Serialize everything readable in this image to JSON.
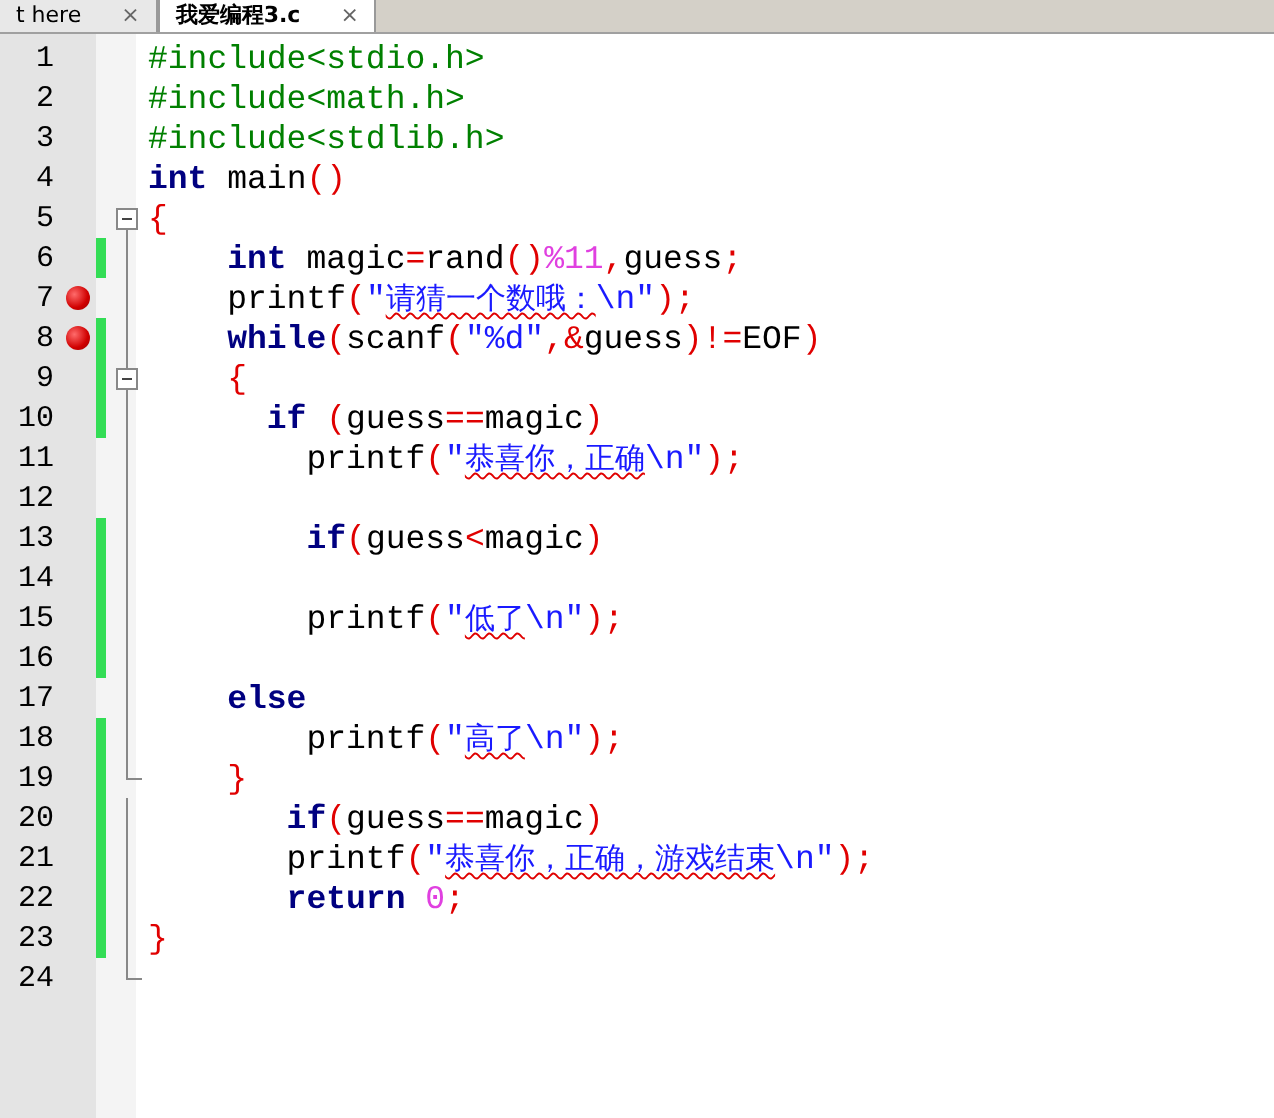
{
  "tabs": [
    {
      "label": "t here",
      "close": "×",
      "selected": false
    },
    {
      "label": "我爱编程3.c",
      "close": "×",
      "selected": true
    }
  ],
  "editor": {
    "lines": [
      {
        "number": "1",
        "breakpoint": false,
        "changed": false,
        "fold_toggle": false,
        "fold_end": false,
        "tokens": [
          {
            "kind": "preproc",
            "text": "#include<stdio.h>"
          }
        ]
      },
      {
        "number": "2",
        "breakpoint": false,
        "changed": false,
        "fold_toggle": false,
        "fold_end": false,
        "tokens": [
          {
            "kind": "preproc",
            "text": "#include<math.h>"
          }
        ]
      },
      {
        "number": "3",
        "breakpoint": false,
        "changed": false,
        "fold_toggle": false,
        "fold_end": false,
        "tokens": [
          {
            "kind": "preproc",
            "text": "#include<stdlib.h>"
          }
        ]
      },
      {
        "number": "4",
        "breakpoint": false,
        "changed": false,
        "fold_toggle": false,
        "fold_end": false,
        "tokens": [
          {
            "kind": "keyword",
            "text": "int"
          },
          {
            "kind": "plain",
            "text": " main"
          },
          {
            "kind": "operator",
            "text": "()"
          }
        ]
      },
      {
        "number": "5",
        "breakpoint": false,
        "changed": false,
        "fold_toggle": true,
        "fold_end": false,
        "tokens": [
          {
            "kind": "operator",
            "text": "{"
          }
        ]
      },
      {
        "number": "6",
        "breakpoint": false,
        "changed": true,
        "fold_toggle": false,
        "fold_end": false,
        "tokens": [
          {
            "kind": "keyword",
            "text": "    int"
          },
          {
            "kind": "plain",
            "text": " magic"
          },
          {
            "kind": "operator",
            "text": "="
          },
          {
            "kind": "plain",
            "text": "rand"
          },
          {
            "kind": "operator",
            "text": "()"
          },
          {
            "kind": "number",
            "text": "%11"
          },
          {
            "kind": "operator",
            "text": ","
          },
          {
            "kind": "plain",
            "text": "guess"
          },
          {
            "kind": "operator",
            "text": ";"
          }
        ]
      },
      {
        "number": "7",
        "breakpoint": true,
        "changed": false,
        "fold_toggle": false,
        "fold_end": false,
        "tokens": [
          {
            "kind": "plain",
            "text": "    printf"
          },
          {
            "kind": "operator",
            "text": "("
          },
          {
            "kind": "string",
            "text": "\""
          },
          {
            "kind": "string_flagged",
            "text": "请猜一个数哦："
          },
          {
            "kind": "string",
            "text": "\\n\""
          },
          {
            "kind": "operator",
            "text": ");"
          }
        ]
      },
      {
        "number": "8",
        "breakpoint": true,
        "changed": true,
        "fold_toggle": false,
        "fold_end": false,
        "tokens": [
          {
            "kind": "keyword",
            "text": "    while"
          },
          {
            "kind": "operator",
            "text": "("
          },
          {
            "kind": "plain",
            "text": "scanf"
          },
          {
            "kind": "operator",
            "text": "("
          },
          {
            "kind": "string",
            "text": "\"%d\""
          },
          {
            "kind": "operator",
            "text": ",&"
          },
          {
            "kind": "plain",
            "text": "guess"
          },
          {
            "kind": "operator",
            "text": ")!="
          },
          {
            "kind": "plain",
            "text": "EOF"
          },
          {
            "kind": "operator",
            "text": ")"
          }
        ]
      },
      {
        "number": "9",
        "breakpoint": false,
        "changed": true,
        "fold_toggle": true,
        "fold_end": false,
        "tokens": [
          {
            "kind": "operator",
            "text": "    {"
          }
        ]
      },
      {
        "number": "10",
        "breakpoint": false,
        "changed": true,
        "fold_toggle": false,
        "fold_end": false,
        "tokens": [
          {
            "kind": "keyword",
            "text": "      if"
          },
          {
            "kind": "operator",
            "text": " ("
          },
          {
            "kind": "plain",
            "text": "guess"
          },
          {
            "kind": "operator",
            "text": "=="
          },
          {
            "kind": "plain",
            "text": "magic"
          },
          {
            "kind": "operator",
            "text": ")"
          }
        ]
      },
      {
        "number": "11",
        "breakpoint": false,
        "changed": false,
        "fold_toggle": false,
        "fold_end": false,
        "tokens": [
          {
            "kind": "plain",
            "text": "        printf"
          },
          {
            "kind": "operator",
            "text": "("
          },
          {
            "kind": "string",
            "text": "\""
          },
          {
            "kind": "string_flagged",
            "text": "恭喜你，正确"
          },
          {
            "kind": "string",
            "text": "\\n\""
          },
          {
            "kind": "operator",
            "text": ");"
          }
        ]
      },
      {
        "number": "12",
        "breakpoint": false,
        "changed": false,
        "fold_toggle": false,
        "fold_end": false
      },
      {
        "number": "13",
        "breakpoint": false,
        "changed": true,
        "fold_toggle": false,
        "fold_end": false,
        "tokens": [
          {
            "kind": "keyword",
            "text": "        if"
          },
          {
            "kind": "operator",
            "text": "("
          },
          {
            "kind": "plain",
            "text": "guess"
          },
          {
            "kind": "operator",
            "text": "<"
          },
          {
            "kind": "plain",
            "text": "magic"
          },
          {
            "kind": "operator",
            "text": ")"
          }
        ]
      },
      {
        "number": "14",
        "breakpoint": false,
        "changed": true,
        "fold_toggle": false,
        "fold_end": false
      },
      {
        "number": "15",
        "breakpoint": false,
        "changed": true,
        "fold_toggle": false,
        "fold_end": false,
        "tokens": [
          {
            "kind": "plain",
            "text": "        printf"
          },
          {
            "kind": "operator",
            "text": "("
          },
          {
            "kind": "string",
            "text": "\""
          },
          {
            "kind": "string_flagged",
            "text": "低了"
          },
          {
            "kind": "string",
            "text": "\\n\""
          },
          {
            "kind": "operator",
            "text": ");"
          }
        ]
      },
      {
        "number": "16",
        "breakpoint": false,
        "changed": true,
        "fold_toggle": false,
        "fold_end": false
      },
      {
        "number": "17",
        "breakpoint": false,
        "changed": false,
        "fold_toggle": false,
        "fold_end": false,
        "tokens": [
          {
            "kind": "keyword",
            "text": "    else"
          }
        ]
      },
      {
        "number": "18",
        "breakpoint": false,
        "changed": true,
        "fold_toggle": false,
        "fold_end": false,
        "tokens": [
          {
            "kind": "plain",
            "text": "        printf"
          },
          {
            "kind": "operator",
            "text": "("
          },
          {
            "kind": "string",
            "text": "\""
          },
          {
            "kind": "string_flagged",
            "text": "高了"
          },
          {
            "kind": "string",
            "text": "\\n\""
          },
          {
            "kind": "operator",
            "text": ");"
          }
        ]
      },
      {
        "number": "19",
        "breakpoint": false,
        "changed": true,
        "fold_toggle": false,
        "fold_end": true,
        "tokens": [
          {
            "kind": "operator",
            "text": "    }"
          }
        ]
      },
      {
        "number": "20",
        "breakpoint": false,
        "changed": true,
        "fold_toggle": false,
        "fold_end": false,
        "tokens": [
          {
            "kind": "keyword",
            "text": "       if"
          },
          {
            "kind": "operator",
            "text": "("
          },
          {
            "kind": "plain",
            "text": "guess"
          },
          {
            "kind": "operator",
            "text": "=="
          },
          {
            "kind": "plain",
            "text": "magic"
          },
          {
            "kind": "operator",
            "text": ")"
          }
        ]
      },
      {
        "number": "21",
        "breakpoint": false,
        "changed": true,
        "fold_toggle": false,
        "fold_end": false,
        "tokens": [
          {
            "kind": "plain",
            "text": "       printf"
          },
          {
            "kind": "operator",
            "text": "("
          },
          {
            "kind": "string",
            "text": "\""
          },
          {
            "kind": "string_flagged",
            "text": "恭喜你，正确，游戏结束"
          },
          {
            "kind": "string",
            "text": "\\n\""
          },
          {
            "kind": "operator",
            "text": ");"
          }
        ]
      },
      {
        "number": "22",
        "breakpoint": false,
        "changed": true,
        "fold_toggle": false,
        "fold_end": false,
        "tokens": [
          {
            "kind": "keyword",
            "text": "       return"
          },
          {
            "kind": "number",
            "text": " 0"
          },
          {
            "kind": "operator",
            "text": ";"
          }
        ]
      },
      {
        "number": "23",
        "breakpoint": false,
        "changed": true,
        "fold_toggle": false,
        "fold_end": false,
        "tokens": [
          {
            "kind": "operator",
            "text": "}"
          }
        ]
      },
      {
        "number": "24",
        "breakpoint": false,
        "changed": false,
        "fold_toggle": false,
        "fold_end": true
      }
    ]
  }
}
